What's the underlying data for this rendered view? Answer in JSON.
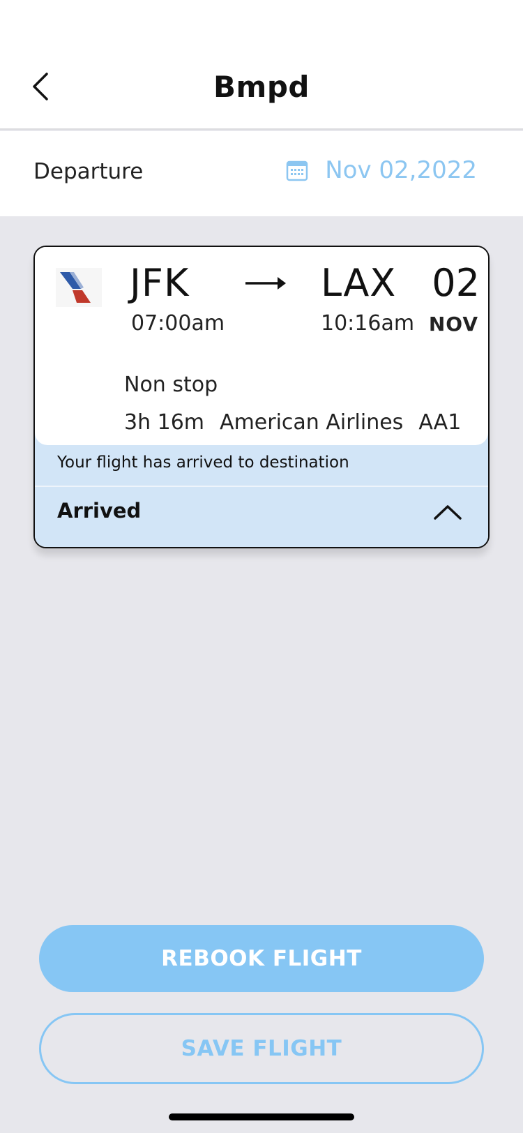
{
  "header": {
    "title": "Bmpd",
    "back_icon": "chevron-left-icon"
  },
  "departure": {
    "label": "Departure",
    "date": "Nov 02,2022",
    "date_color": "#8cc6f1",
    "icon": "calendar-icon"
  },
  "flight": {
    "airline_logo": "american-airlines-logo",
    "from_code": "JFK",
    "to_code": "LAX",
    "departure_time": "07:00am",
    "arrival_time": "10:16am",
    "day": "02",
    "month": "NOV",
    "stops": "Non stop",
    "duration": "3h 16m",
    "airline": "American Airlines",
    "flight_number": "AA1"
  },
  "status": {
    "message": "Your flight has arrived to destination",
    "label": "Arrived",
    "background": "#d2e5f7",
    "toggle_icon": "chevron-up-icon"
  },
  "actions": {
    "rebook_label": "REBOOK FLIGHT",
    "save_label": "SAVE FLIGHT",
    "accent": "#86c6f4"
  }
}
